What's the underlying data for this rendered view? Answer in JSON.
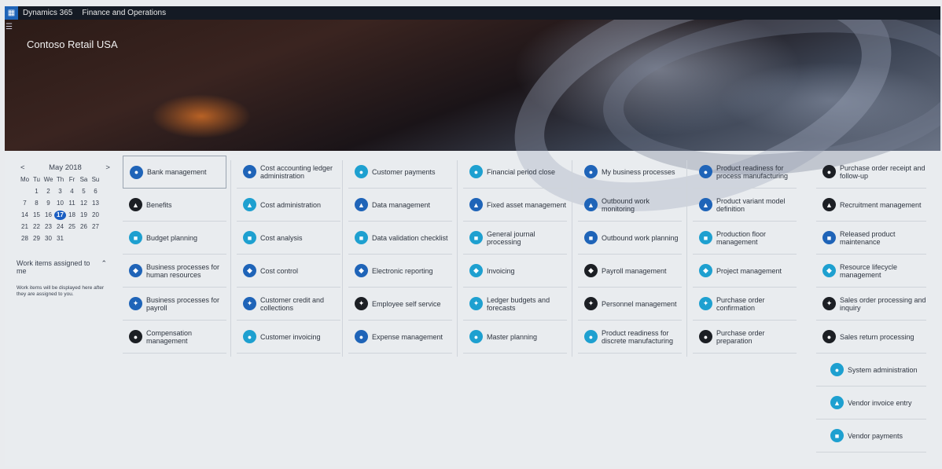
{
  "topbar": {
    "brand": "Dynamics 365",
    "module": "Finance and Operations"
  },
  "company": "Contoso Retail USA",
  "calendar": {
    "month": "May  2018",
    "prev": "<",
    "next": ">",
    "weekdays": [
      "Mo",
      "Tu",
      "We",
      "Th",
      "Fr",
      "Sa",
      "Su"
    ],
    "weeks": [
      [
        "",
        "1",
        "2",
        "3",
        "4",
        "5",
        "6"
      ],
      [
        "7",
        "8",
        "9",
        "10",
        "11",
        "12",
        "13"
      ],
      [
        "14",
        "15",
        "16",
        "17",
        "18",
        "19",
        "20"
      ],
      [
        "21",
        "22",
        "23",
        "24",
        "25",
        "26",
        "27"
      ],
      [
        "28",
        "29",
        "30",
        "31",
        "",
        "",
        ""
      ]
    ],
    "today": "17"
  },
  "work_items": {
    "title": "Work items assigned to me",
    "message": "Work items will be displayed here after they are assigned to you."
  },
  "colors": {
    "blue": "#1f64b8",
    "teal": "#1ea0d0",
    "dark": "#1c1f24"
  },
  "tiles": [
    [
      {
        "label": "Bank management",
        "color": "blue",
        "icon": "bank-icon"
      },
      {
        "label": "Benefits",
        "color": "dark",
        "icon": "benefits-icon"
      },
      {
        "label": "Budget planning",
        "color": "teal",
        "icon": "budget-icon"
      },
      {
        "label": "Business processes for human resources",
        "color": "blue",
        "icon": "hr-process-icon"
      },
      {
        "label": "Business processes for payroll",
        "color": "blue",
        "icon": "payroll-process-icon"
      },
      {
        "label": "Compensation management",
        "color": "dark",
        "icon": "compensation-icon"
      }
    ],
    [
      {
        "label": "Cost accounting ledger administration",
        "color": "blue",
        "icon": "ledger-icon"
      },
      {
        "label": "Cost administration",
        "color": "teal",
        "icon": "cost-admin-icon"
      },
      {
        "label": "Cost analysis",
        "color": "teal",
        "icon": "cost-analysis-icon"
      },
      {
        "label": "Cost control",
        "color": "blue",
        "icon": "cost-control-icon"
      },
      {
        "label": "Customer credit and collections",
        "color": "blue",
        "icon": "credit-icon"
      },
      {
        "label": "Customer invoicing",
        "color": "teal",
        "icon": "invoice-icon"
      }
    ],
    [
      {
        "label": "Customer payments",
        "color": "teal",
        "icon": "payments-icon"
      },
      {
        "label": "Data management",
        "color": "blue",
        "icon": "data-icon"
      },
      {
        "label": "Data validation checklist",
        "color": "teal",
        "icon": "checklist-icon"
      },
      {
        "label": "Electronic reporting",
        "color": "blue",
        "icon": "report-icon"
      },
      {
        "label": "Employee self service",
        "color": "dark",
        "icon": "employee-icon"
      },
      {
        "label": "Expense management",
        "color": "blue",
        "icon": "expense-icon"
      }
    ],
    [
      {
        "label": "Financial period close",
        "color": "teal",
        "icon": "period-close-icon"
      },
      {
        "label": "Fixed asset management",
        "color": "blue",
        "icon": "asset-icon"
      },
      {
        "label": "General journal processing",
        "color": "teal",
        "icon": "journal-icon"
      },
      {
        "label": "Invoicing",
        "color": "teal",
        "icon": "invoicing-icon"
      },
      {
        "label": "Ledger budgets and forecasts",
        "color": "teal",
        "icon": "forecast-icon"
      },
      {
        "label": "Master planning",
        "color": "teal",
        "icon": "planning-icon"
      }
    ],
    [
      {
        "label": "My business processes",
        "color": "blue",
        "icon": "business-process-icon"
      },
      {
        "label": "Outbound work monitoring",
        "color": "blue",
        "icon": "monitor-icon"
      },
      {
        "label": "Outbound work planning",
        "color": "blue",
        "icon": "work-planning-icon"
      },
      {
        "label": "Payroll management",
        "color": "dark",
        "icon": "payroll-icon"
      },
      {
        "label": "Personnel management",
        "color": "dark",
        "icon": "personnel-icon"
      },
      {
        "label": "Product readiness for discrete manufacturing",
        "color": "teal",
        "icon": "discrete-icon"
      }
    ],
    [
      {
        "label": "Product readiness for process manufacturing",
        "color": "blue",
        "icon": "process-mfg-icon"
      },
      {
        "label": "Product variant model definition",
        "color": "blue",
        "icon": "variant-icon"
      },
      {
        "label": "Production floor management",
        "color": "teal",
        "icon": "floor-icon"
      },
      {
        "label": "Project management",
        "color": "teal",
        "icon": "project-icon"
      },
      {
        "label": "Purchase order confirmation",
        "color": "teal",
        "icon": "po-confirm-icon"
      },
      {
        "label": "Purchase order preparation",
        "color": "dark",
        "icon": "po-prep-icon"
      }
    ],
    [
      {
        "label": "Purchase order receipt and follow-up",
        "color": "dark",
        "icon": "receipt-icon"
      },
      {
        "label": "Recruitment management",
        "color": "dark",
        "icon": "recruit-icon"
      },
      {
        "label": "Released product maintenance",
        "color": "blue",
        "icon": "released-icon"
      },
      {
        "label": "Resource lifecycle management",
        "color": "teal",
        "icon": "lifecycle-icon"
      },
      {
        "label": "Sales order processing and inquiry",
        "color": "dark",
        "icon": "sales-icon"
      },
      {
        "label": "Sales return processing",
        "color": "dark",
        "icon": "return-icon"
      },
      {
        "label": "System administration",
        "color": "teal",
        "icon": "sysadmin-icon"
      },
      {
        "label": "Vendor invoice entry",
        "color": "teal",
        "icon": "vendor-invoice-icon"
      },
      {
        "label": "Vendor payments",
        "color": "teal",
        "icon": "vendor-payments-icon"
      }
    ]
  ]
}
